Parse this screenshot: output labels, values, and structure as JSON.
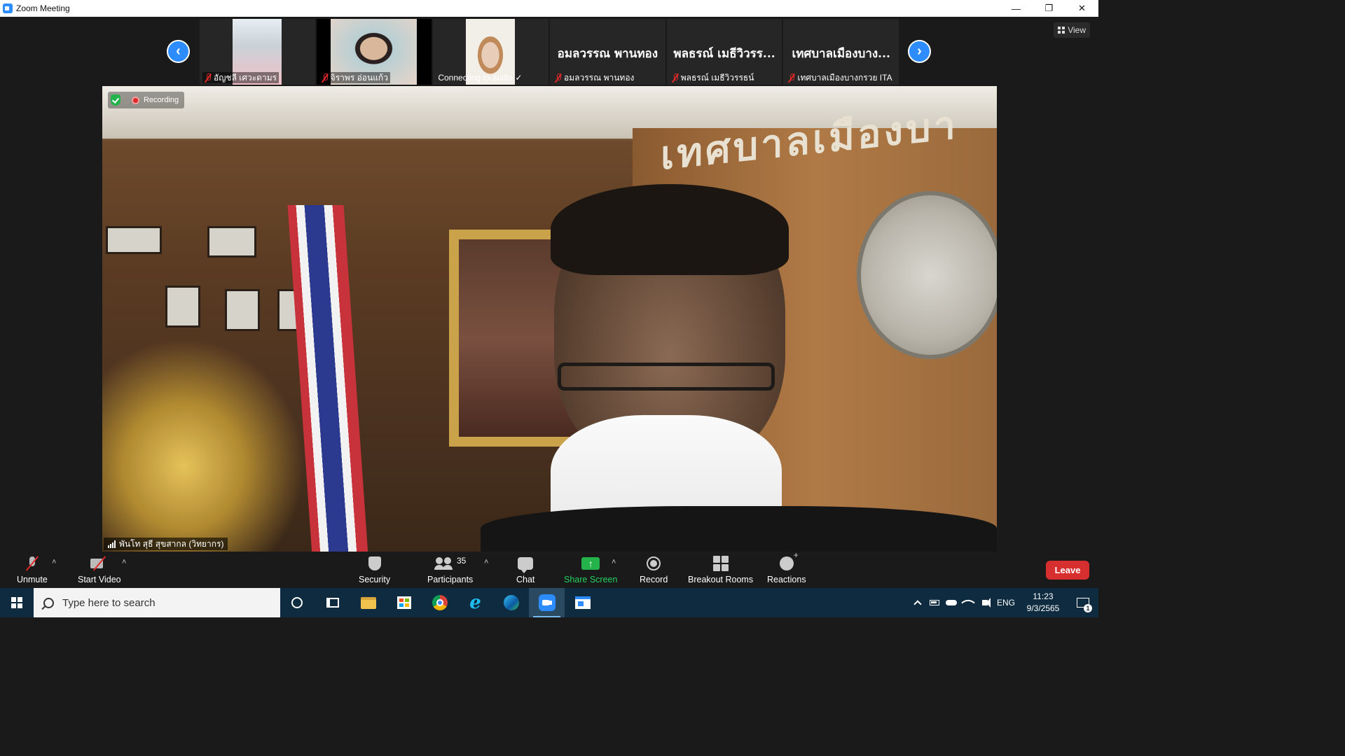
{
  "window": {
    "title": "Zoom Meeting",
    "controls": {
      "minimize": "—",
      "restore": "❐",
      "close": "✕"
    }
  },
  "thumbnails": [
    {
      "name": "อัญชลี เศวะดามร",
      "muted": true,
      "type": "video"
    },
    {
      "name": "จิราพร อ่อนแก้ว",
      "muted": true,
      "type": "video"
    },
    {
      "name": "Connecting to audio ✓",
      "muted": false,
      "type": "video"
    },
    {
      "display_name": "อมลวรรณ พานทอง",
      "name": "อมลวรรณ พานทอง",
      "muted": true,
      "type": "name"
    },
    {
      "display_name": "พลธรณ์ เมธีวิวรร...",
      "name": "พลธรณ์ เมธีวิวรรธน์",
      "muted": true,
      "type": "name"
    },
    {
      "display_name": "เทศบาลเมืองบาง...",
      "name": "เทศบาลเมืองบางกรวย ITA",
      "muted": true,
      "type": "name"
    }
  ],
  "nav": {
    "prev": "‹",
    "next": "›"
  },
  "view_button": {
    "label": "View"
  },
  "main_video": {
    "recording_label": "Recording",
    "speaker_name": "พันโท สุธี สุขสากล (วิทยากร)",
    "sign_text": "เทศบาลเมืองบา"
  },
  "toolbar": {
    "unmute": "Unmute",
    "start_video": "Start Video",
    "security": "Security",
    "participants": "Participants",
    "participants_count": "35",
    "chat": "Chat",
    "share_screen": "Share Screen",
    "record": "Record",
    "breakout_rooms": "Breakout Rooms",
    "reactions": "Reactions",
    "leave": "Leave",
    "caret": "˄",
    "share_arrow": "↑"
  },
  "taskbar": {
    "search_placeholder": "Type here to search",
    "language": "ENG",
    "time": "11:23",
    "date": "9/3/2565",
    "notification_count": "1",
    "ie_glyph": "e"
  },
  "colors": {
    "zoom_blue": "#2d8cff",
    "leave_red": "#d72f2f",
    "share_green": "#23b34a",
    "taskbar": "#0e2b40"
  }
}
